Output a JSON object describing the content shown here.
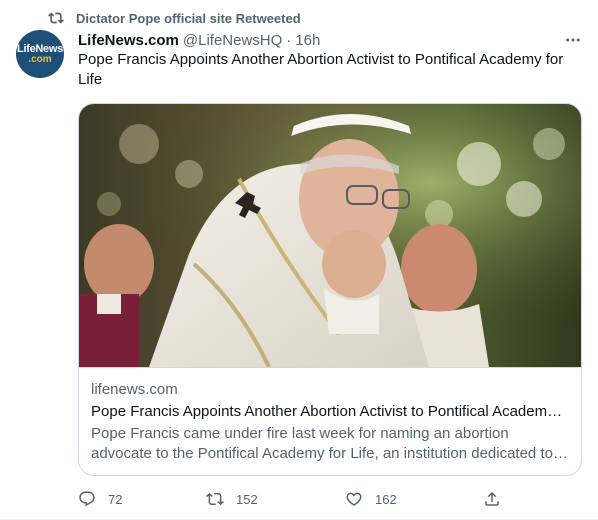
{
  "retweet": {
    "icon": "retweet-icon",
    "label": "Dictator Pope official site Retweeted"
  },
  "author": {
    "avatar_text_top": "LifeNews",
    "avatar_text_bottom": ".com",
    "name": "LifeNews.com",
    "handle": "@LifeNewsHQ",
    "separator": "·",
    "time": "16h"
  },
  "tweet": {
    "text": "Pope Francis Appoints Another Abortion Activist to Pontifical Academy for Life"
  },
  "card": {
    "domain": "lifenews.com",
    "title": "Pope Francis Appoints Another Abortion Activist to Pontifical Academy for Life",
    "description": "Pope Francis came under fire last week for naming an abortion advocate to the Pontifical Academy for Life, an institution dedicated to promoting life"
  },
  "actions": {
    "reply_count": "72",
    "retweet_count": "152",
    "like_count": "162"
  },
  "colors": {
    "secondary_text": "#536471",
    "primary_text": "#0f1419",
    "border": "#cfd9de",
    "avatar_bg": "#1f4e79"
  }
}
